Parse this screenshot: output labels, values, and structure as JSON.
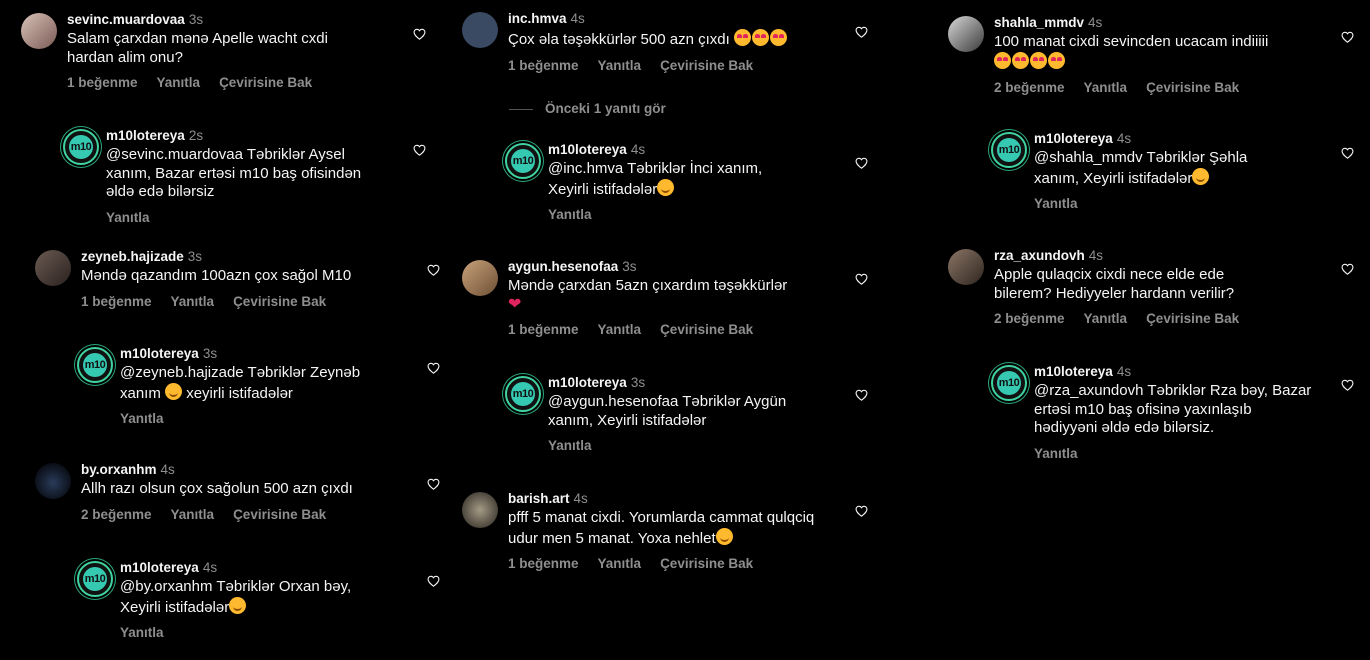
{
  "actions": {
    "likes_1": "1 beğenme",
    "likes_2": "2 beğenme",
    "reply": "Yanıtla",
    "translate": "Çevirisine Bak"
  },
  "c1": {
    "user": "sevinc.muardovaa",
    "time": "3s",
    "text": "Salam çarxdan mənə Apelle wacht cxdi hardan alim onu?"
  },
  "r1": {
    "user": "m10lotereya",
    "time": "2s",
    "text": "@sevinc.muardovaa Təbriklər Aysel xanım, Bazar ertəsi m10 baş ofisindən əldə edə bilərsiz"
  },
  "c2": {
    "user": "zeyneb.hajizade",
    "time": "3s",
    "text": "Məndə qazandım 100azn çox sağol M10"
  },
  "r2": {
    "user": "m10lotereya",
    "time": "3s",
    "text_a": "@zeyneb.hajizade Təbriklər Zeynəb xanım",
    "text_b": "xeyirli istifadələr"
  },
  "c3": {
    "user": "by.orxanhm",
    "time": "4s",
    "text": "Allh razı olsun çox sağolun 500 azn çıxdı"
  },
  "r3": {
    "user": "m10lotereya",
    "time": "4s",
    "text": "@by.orxanhm Təbriklər Orxan bəy, Xeyirli istifadələr"
  },
  "c4": {
    "user": "inc.hmva",
    "time": "4s",
    "text": "Çox əla təşəkkürlər 500 azn çıxdı"
  },
  "prev_replies": "Önceki 1 yanıtı gör",
  "r4": {
    "user": "m10lotereya",
    "time": "4s",
    "text": "@inc.hmva Təbriklər İnci xanım, Xeyirli istifadələr"
  },
  "c5": {
    "user": "aygun.hesenofaa",
    "time": "3s",
    "text": "Məndə çarxdan 5azn çıxardım təşəkkürlər"
  },
  "r5": {
    "user": "m10lotereya",
    "time": "3s",
    "text": "@aygun.hesenofaa Təbriklər Aygün xanım, Xeyirli istifadələr"
  },
  "c6": {
    "user": "barish.art",
    "time": "4s",
    "text": "pfff 5 manat cixdi. Yorumlarda cammat qulqciq udur men 5 manat. Yoxa nehlet"
  },
  "c7": {
    "user": "shahla_mmdv",
    "time": "4s",
    "text": "100 manat cixdi sevincden ucacam indiiiii"
  },
  "r7": {
    "user": "m10lotereya",
    "time": "4s",
    "text": "@shahla_mmdv Təbriklər Şəhla xanım, Xeyirli istifadələr"
  },
  "c8": {
    "user": "rza_axundovh",
    "time": "4s",
    "text": "Apple qulaqcix cixdi nece elde ede bilerem? Hediyyeler hardann verilir?"
  },
  "r8": {
    "user": "m10lotereya",
    "time": "4s",
    "text": "@rza_axundovh Təbriklər Rza bəy, Bazar ertəsi m10 baş ofisinə yaxınlaşıb hədiyyəni əldə edə bilərsiz."
  },
  "avatar_logo": "m10",
  "colors": {
    "bg": "#000000",
    "text": "#f5f5f5",
    "muted": "#8e8e8e",
    "m10_ring": "#3fd3a0"
  }
}
